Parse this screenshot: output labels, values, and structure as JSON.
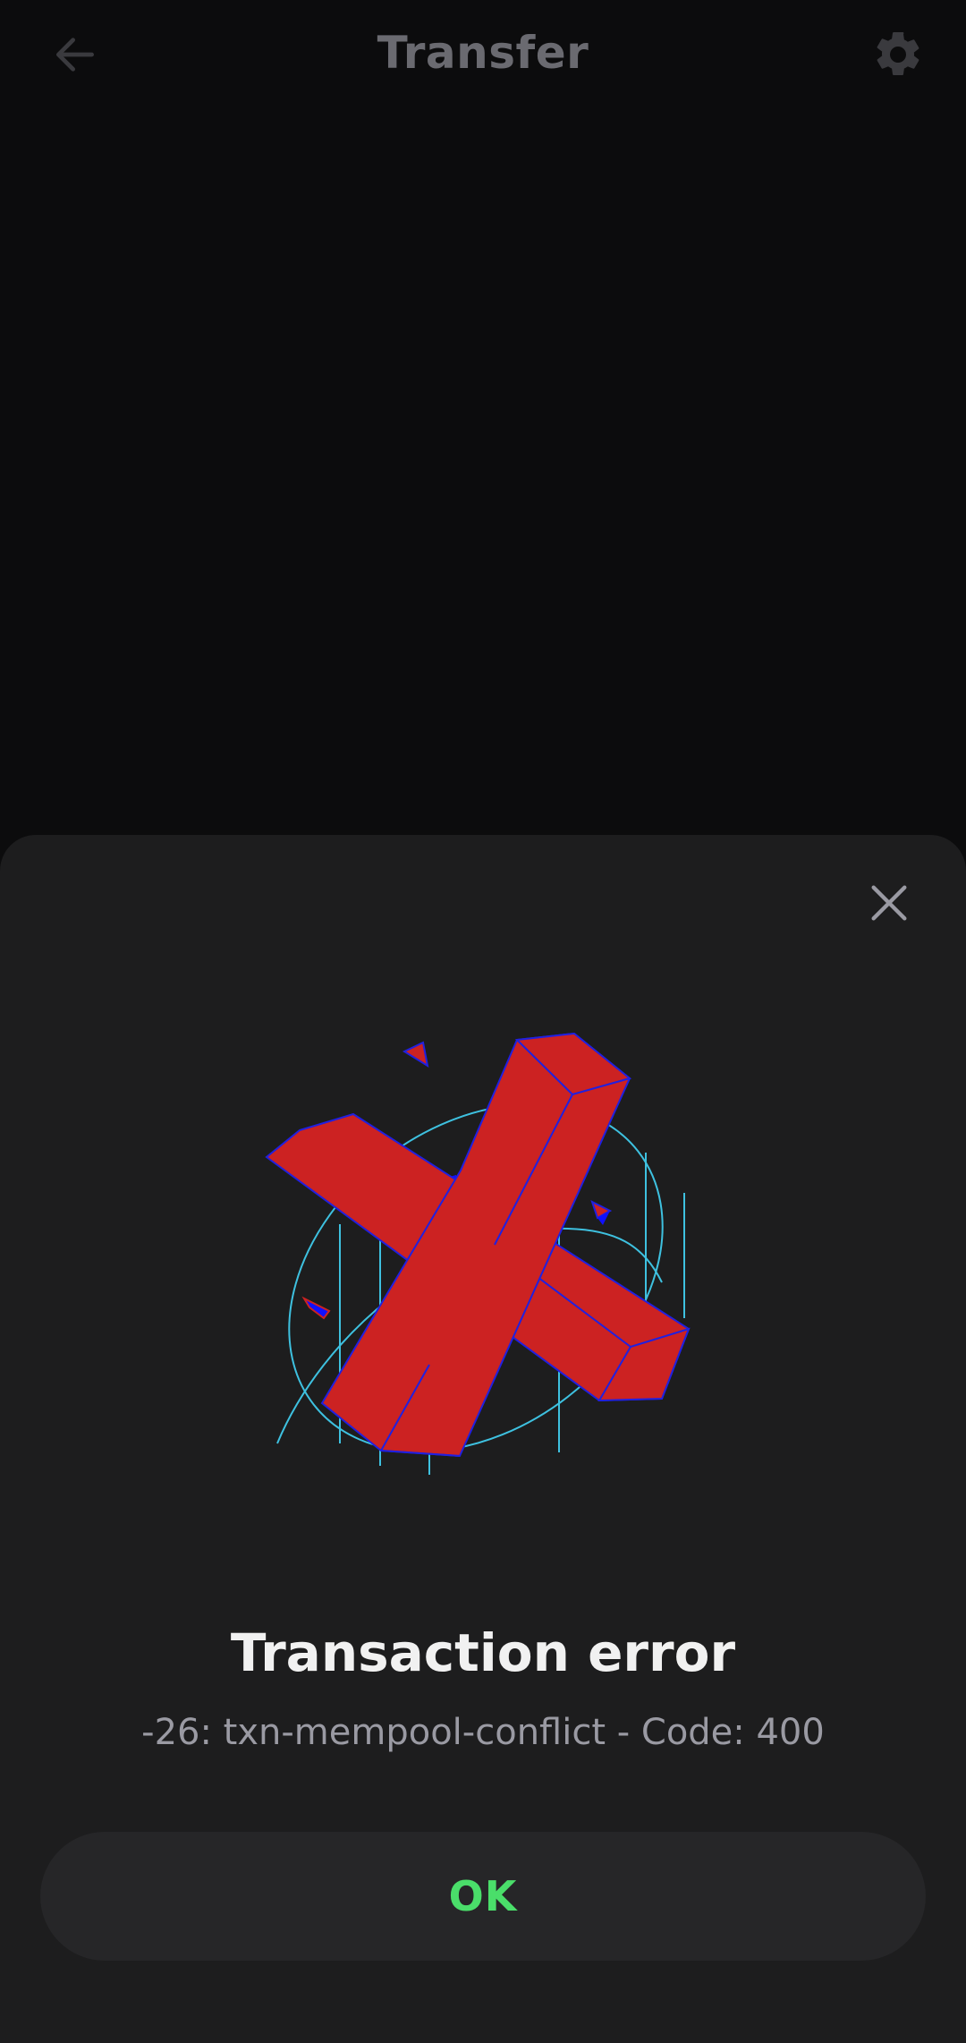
{
  "header": {
    "title": "Transfer",
    "back_icon": "arrow-left-icon",
    "settings_icon": "gear-icon"
  },
  "modal": {
    "close_icon": "close-icon",
    "illustration": "error-x-icon",
    "title": "Transaction error",
    "message": "-26: txn-mempool-conflict - Code: 400",
    "ok_label": "OK"
  },
  "colors": {
    "background": "#0c0c0d",
    "sheet": "#1d1d1e",
    "button_bg": "#262628",
    "accent_green": "#4ade6a",
    "error_red": "#cc2222",
    "outline_blue": "#2020e0",
    "ring_cyan": "#3ec1e0"
  }
}
